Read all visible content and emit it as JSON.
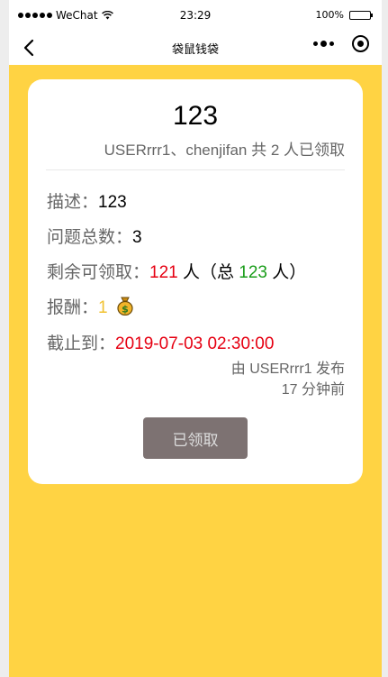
{
  "status": {
    "carrier": "WeChat",
    "time": "23:29",
    "battery": "100%"
  },
  "nav": {
    "title": "袋鼠钱袋"
  },
  "task": {
    "title": "123",
    "receivers": "USERrrr1、chenjifan 共 2 人已领取",
    "desc_label": "描述：",
    "desc_value": "123",
    "questions_label": "问题总数：",
    "questions_value": "3",
    "remaining_label": "剩余可领取：",
    "remaining_value": "121",
    "person_unit": " 人",
    "total_open": "（总 ",
    "total_value": "123",
    "total_close": " 人）",
    "reward_label": "报酬：",
    "reward_value": "1",
    "deadline_label": "截止到：",
    "deadline_value": "2019-07-03 02:30:00",
    "publisher": "由 USERrrr1 发布",
    "published_ago": "17 分钟前",
    "button_label": "已领取"
  },
  "colors": {
    "background": "#ffd343",
    "button": "#7d7272",
    "red": "#e60012",
    "green": "#1a9d1a"
  }
}
